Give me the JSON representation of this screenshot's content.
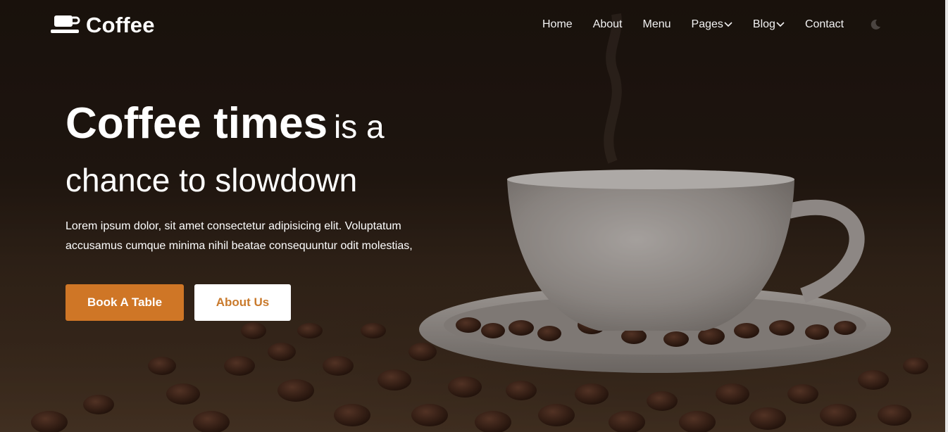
{
  "brand": {
    "name": "Coffee",
    "icon": "coffee-cup-icon"
  },
  "nav": {
    "items": [
      {
        "label": "Home"
      },
      {
        "label": "About"
      },
      {
        "label": "Menu"
      },
      {
        "label": "Pages",
        "dropdown": true
      },
      {
        "label": "Blog",
        "dropdown": true
      },
      {
        "label": "Contact"
      }
    ],
    "theme_toggle_icon": "moon-icon"
  },
  "hero": {
    "headline_strong": "Coffee times",
    "headline_light": "is a",
    "headline_line2": "chance to slowdown",
    "subtext": "Lorem ipsum dolor, sit amet consectetur adipisicing elit. Voluptatum accusamus cumque minima nihil beatae consequuntur odit molestias,",
    "primary_button": "Book A Table",
    "secondary_button": "About Us"
  },
  "colors": {
    "accent": "#cf7626",
    "secondary_text": "#c97a2c",
    "overlay": "#1c140f"
  }
}
